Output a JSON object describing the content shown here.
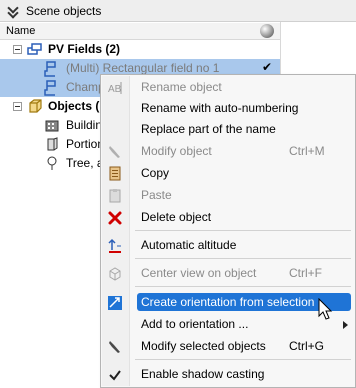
{
  "panel": {
    "title": "Scene objects",
    "column_name": "Name"
  },
  "tree": {
    "pv_fields": {
      "label": "PV Fields (2)",
      "icon": "pv-field-group-icon"
    },
    "child1": {
      "label": "(Multi) Rectangular field no 1",
      "checked": "✔"
    },
    "child2": {
      "label": "Champ"
    },
    "objects": {
      "label": "Objects ("
    },
    "building": {
      "label": "Building"
    },
    "portion": {
      "label": "Portion"
    },
    "tree_item": {
      "label": "Tree, a"
    }
  },
  "menu": {
    "items": [
      {
        "label": "Rename object",
        "shortcut": "",
        "icon": "rename-icon",
        "disabled": true
      },
      {
        "label": "Rename with auto-numbering",
        "shortcut": "",
        "icon": "",
        "disabled": false
      },
      {
        "label": "Replace part of the name",
        "shortcut": "",
        "icon": "",
        "disabled": false
      },
      {
        "label": "Modify object",
        "shortcut": "Ctrl+M",
        "icon": "wrench-icon",
        "disabled": true
      },
      {
        "label": "Copy",
        "shortcut": "",
        "icon": "copy-icon",
        "disabled": false
      },
      {
        "label": "Paste",
        "shortcut": "",
        "icon": "paste-icon",
        "disabled": true
      },
      {
        "label": "Delete object",
        "shortcut": "",
        "icon": "delete-icon",
        "disabled": false
      },
      {
        "label": "Automatic altitude",
        "shortcut": "",
        "icon": "altitude-icon",
        "disabled": false
      },
      {
        "label": "Center view on object",
        "shortcut": "Ctrl+F",
        "icon": "center-view-icon",
        "disabled": true
      },
      {
        "label": "Create orientation from selection",
        "shortcut": "",
        "icon": "orientation-icon",
        "disabled": false,
        "highlighted": true
      },
      {
        "label": "Add to orientation ...",
        "shortcut": "",
        "icon": "",
        "disabled": false,
        "submenu": true
      },
      {
        "label": "Modify selected objects",
        "shortcut": "Ctrl+G",
        "icon": "wrench-icon",
        "disabled": false
      },
      {
        "label": "Enable shadow casting",
        "shortcut": "",
        "icon": "checkmark-icon",
        "disabled": false
      }
    ]
  },
  "colors": {
    "selection_row": "#a9c8ec",
    "menu_highlight": "#1f74d6",
    "delete_red": "#d00000",
    "pv_blue": "#2b5fb8"
  }
}
